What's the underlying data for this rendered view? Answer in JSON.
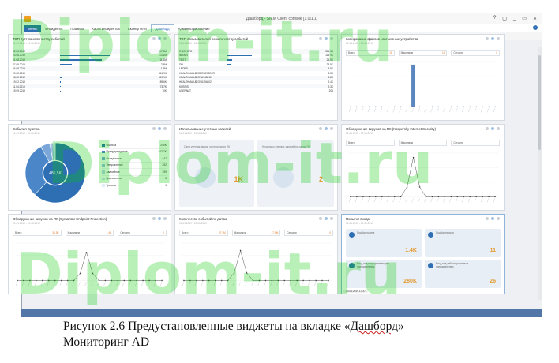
{
  "window": {
    "title": "Дашборд - SIEM Client console [1.0t1.1]",
    "controls": [
      "?",
      "▢",
      "_",
      "▭",
      "✕"
    ]
  },
  "tabs": [
    {
      "label": "Меню"
    },
    {
      "label": "Инциденты"
    },
    {
      "label": "Правила"
    },
    {
      "label": "Карта инцидентов"
    },
    {
      "label": "Сканер сети"
    },
    {
      "label": "Дашборд"
    },
    {
      "label": "Администрирование"
    }
  ],
  "toolbar": {
    "add_label": "Добавить виджет"
  },
  "widgets": {
    "top_pc": {
      "title": "ТОП ∂уст по количеству событий",
      "date": "01.01.2019 - 10.06.2019",
      "rows": [
        {
          "k": "02.08.2019",
          "v": "17.9M",
          "f": 0.8
        },
        {
          "k": "03.08.2019",
          "v": "13.1M",
          "f": 0.6
        },
        {
          "k": "01.08.2019",
          "v": "11.1M",
          "f": 0.5
        },
        {
          "k": "27.09.2019",
          "v": "2.5M",
          "f": 0.14
        },
        {
          "k": "04.08.2019",
          "v": "1.6M",
          "f": 0.08
        },
        {
          "k": "20.02.2019",
          "v": "311.9K",
          "f": 0.03
        },
        {
          "k": "18.02.2019",
          "v": "119.1K",
          "f": 0.02
        },
        {
          "k": "19.02.2019",
          "v": "89.6K",
          "f": 0.01
        },
        {
          "k": "11.04.2019",
          "v": "73.7K",
          "f": 0.01
        },
        {
          "k": "19.09.2019",
          "v": "70K",
          "f": 0.01
        }
      ]
    },
    "top_users": {
      "title": "ТОП пользователей по количеству событий",
      "date": "01.01.2019 - 10.06.2019",
      "rows": [
        {
          "k": "R.BOLOTO",
          "v": "311.3K",
          "f": 0.8
        },
        {
          "k": "IBRAIN",
          "v": "113.9K",
          "f": 0.3
        },
        {
          "k": "TEST",
          "v": "24.9K",
          "f": 0.07
        },
        {
          "k": "DBI",
          "v": "23.9K",
          "f": 0.06
        },
        {
          "k": "LRDPR",
          "v": "5.5K",
          "f": 0.02
        },
        {
          "k": "HEALTHMAIL$USERS09SECR",
          "v": "3.3K",
          "f": 0.01
        },
        {
          "k": "HEALTHMAIL$EOVA148212",
          "v": "3.8K",
          "f": 0.01
        },
        {
          "k": "HEALTHMAIL$EOVA154802",
          "v": "2.4K",
          "f": 0.01
        },
        {
          "k": "KUSSIS",
          "v": "2.3K",
          "f": 0.01
        },
        {
          "k": "USERNAT",
          "v": "206",
          "f": 0.0
        }
      ]
    },
    "removable": {
      "title": "Копирование файлов на съемные устройства",
      "date": "01.01.2019 - 10.06.2019",
      "stats": [
        {
          "k": "Всего",
          "v": "15"
        },
        {
          "k": "Максимум",
          "v": "11"
        },
        {
          "k": "Сегодня",
          "v": "0"
        }
      ]
    },
    "sysmon": {
      "title": "События Sysmon",
      "date": "01.01.2019 - 10.06.2019",
      "center": "486,5K",
      "legend": [
        {
          "k": "Ошибка",
          "v": "240K",
          "c": "#2e6fb3"
        },
        {
          "k": "Предупреждение",
          "v": "142.7K",
          "c": "#4a86c8"
        },
        {
          "k": "Отладочное",
          "v": "447",
          "c": "#7aa7d8"
        },
        {
          "k": "Уведомление",
          "v": "392",
          "c": "#9fc0e4"
        },
        {
          "k": "Аварийное",
          "v": "159",
          "c": "#b9d2ec"
        },
        {
          "k": "Критическое",
          "v": "3",
          "c": "#cfe0f2"
        },
        {
          "k": "Тревога",
          "v": "1",
          "c": "#e1ecf7"
        }
      ],
      "slices": [
        0.62,
        0.3,
        0.05,
        0.02,
        0.01
      ]
    },
    "accounts": {
      "title": "Использование учетных записей",
      "date": "01.01.2019 - 10.06.2019",
      "cards": [
        {
          "t": "Одна учетная запись на нескольких ПК",
          "v": "1K"
        },
        {
          "t": "Несколько учетных записей на одном ПК",
          "v": "2"
        }
      ]
    },
    "kaspersky": {
      "title": "Обнаружение вирусов на ПК (Kaspersky Internet Security)",
      "date": "01.01.2019 - 10.06.2019",
      "stats": [
        {
          "k": "Всего",
          "v": ""
        },
        {
          "k": "Максимум",
          "v": ""
        },
        {
          "k": "Сегодня",
          "v": ""
        }
      ]
    },
    "kaspersky_chart": {
      "peak_index": 10,
      "peak": 0.9
    },
    "symantec": {
      "title": "Обнаружение вирусов на ПК (Symantec Endpoint Protection)",
      "date": "01.01.2019 - 10.06.2019",
      "stats": [
        {
          "k": "Всего",
          "v": "31.9K"
        },
        {
          "k": "Максимум",
          "v": "1.4K"
        },
        {
          "k": "Сегодня",
          "v": "0"
        }
      ]
    },
    "symantec_chart": {
      "peak_index": 11,
      "peak": 0.75
    },
    "events_by_date": {
      "title": "Количество событий по датам",
      "date": "01.01.2019 - 10.06.2019",
      "stats": [
        {
          "k": "Всего",
          "v": "47.1M"
        },
        {
          "k": "Максимум",
          "v": "17.9M"
        },
        {
          "k": "Сегодня",
          "v": "0"
        }
      ]
    },
    "events_chart": {
      "peak_index": 9,
      "peak": 0.8
    },
    "logins": {
      "title": "Попытки входа",
      "date": "01.01.2019 - 10.06.2019",
      "cards": [
        {
          "t": "Подбор логина",
          "v": "1.4K"
        },
        {
          "t": "Подбор пароля",
          "v": "11"
        },
        {
          "t": "Вход под несуществующим пользователем",
          "v": "280K"
        },
        {
          "t": "Вход под заблокированным пользователем",
          "v": "26"
        }
      ],
      "status": "10.06.2019 17:37"
    }
  },
  "caption": {
    "line1a": "Рисунок 2.6  Предустановленные виджеты на вкладке «",
    "line1b": "Дашборд",
    "line1c": "»",
    "line2": "Мониторинг AD"
  },
  "watermark": "Diplom-it.ru"
}
